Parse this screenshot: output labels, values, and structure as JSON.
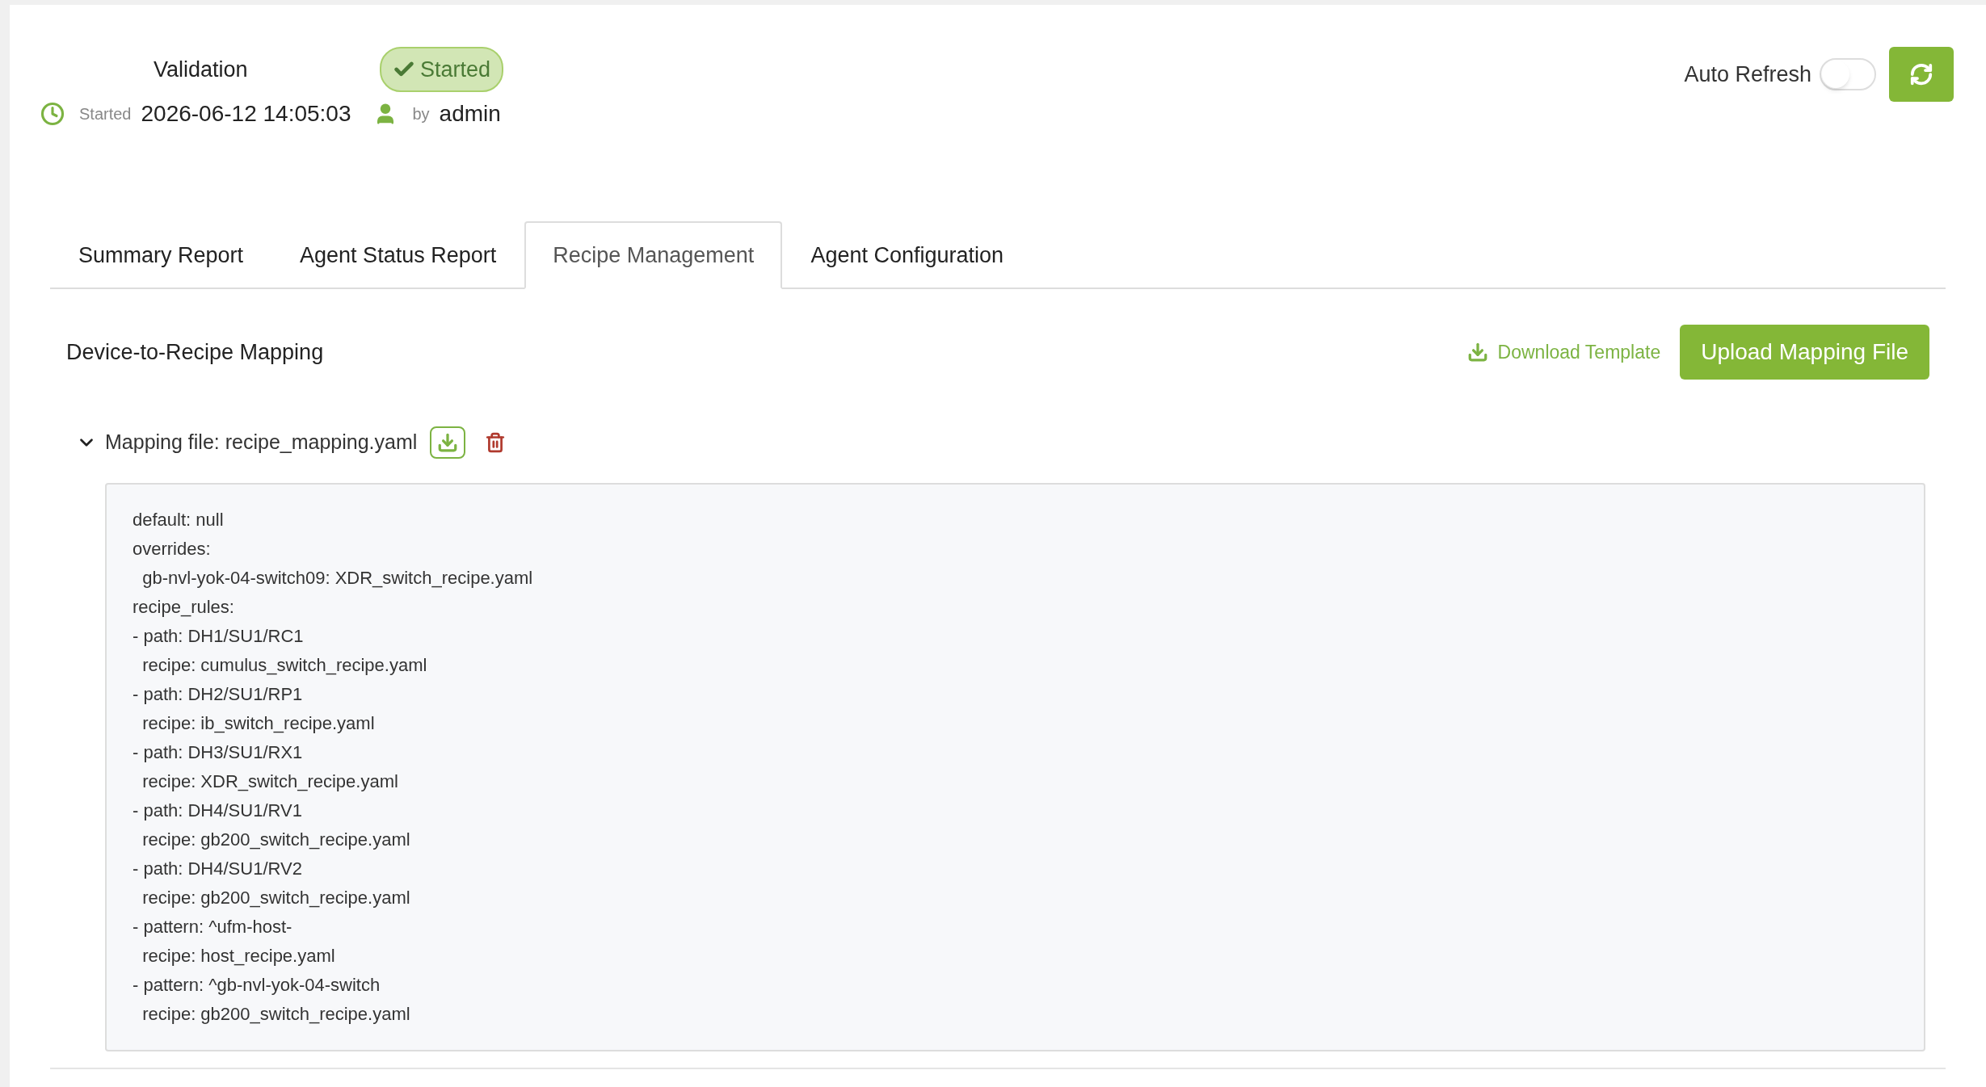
{
  "header": {
    "title": "Validation",
    "status": {
      "label": "Started",
      "kind": "success"
    },
    "started_label": "Started",
    "started_time": "2026-06-12 14:05:03",
    "by_label": "by",
    "user": "admin"
  },
  "auto_refresh": {
    "label": "Auto Refresh",
    "on": false
  },
  "tabs": [
    {
      "label": "Summary Report",
      "selected": false
    },
    {
      "label": "Agent Status Report",
      "selected": false
    },
    {
      "label": "Recipe Management",
      "selected": true
    },
    {
      "label": "Agent Configuration",
      "selected": false
    }
  ],
  "section": {
    "title": "Device-to-Recipe Mapping",
    "download_link": "Download Template",
    "upload_button": "Upload Mapping File"
  },
  "mapping_file": {
    "label": "Mapping file: recipe_mapping.yaml",
    "expanded": true,
    "lines": [
      "default: null",
      "overrides:",
      "  gb-nvl-yok-04-switch09: XDR_switch_recipe.yaml",
      "recipe_rules:",
      "- path: DH1/SU1/RC1",
      "  recipe: cumulus_switch_recipe.yaml",
      "- path: DH2/SU1/RP1",
      "  recipe: ib_switch_recipe.yaml",
      "- path: DH3/SU1/RX1",
      "  recipe: XDR_switch_recipe.yaml",
      "- path: DH4/SU1/RV1",
      "  recipe: gb200_switch_recipe.yaml",
      "- path: DH4/SU1/RV2",
      "  recipe: gb200_switch_recipe.yaml",
      "- pattern: ^ufm-host-",
      "  recipe: host_recipe.yaml",
      "- pattern: ^gb-nvl-yok-04-switch",
      "  recipe: gb200_switch_recipe.yaml"
    ]
  }
}
